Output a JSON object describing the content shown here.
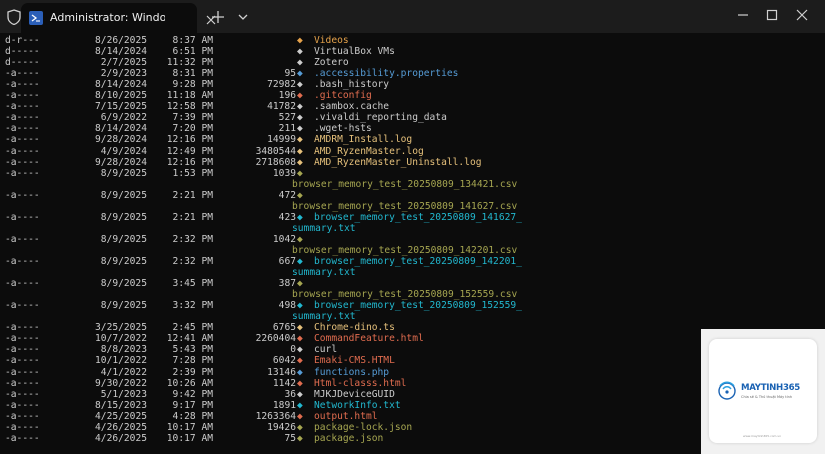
{
  "window": {
    "tab_title": "Administrator: Windows Powe",
    "tab_icon": "powershell-icon"
  },
  "colors": {
    "terminal_bg": "#0c0c0c",
    "titlebar_bg": "#1c1c1c",
    "default_text": "#cccccc",
    "yellow": "#e5c07b",
    "blue": "#569cd6",
    "red": "#e06c4f",
    "cyan": "#22b8cf",
    "olive": "#a6a651"
  },
  "listing": [
    {
      "mode": "d-r---",
      "date": "8/26/2025",
      "time": "8:37",
      "ampm": "AM",
      "size": "",
      "icon": "◆",
      "icon_color": "#e5a24b",
      "name": "Videos",
      "name_color": "#e5a24b"
    },
    {
      "mode": "d-----",
      "date": "8/14/2024",
      "time": "6:51",
      "ampm": "PM",
      "size": "",
      "icon": "◆",
      "icon_color": "#cccccc",
      "name": "VirtualBox VMs",
      "name_color": "#cccccc"
    },
    {
      "mode": "d-----",
      "date": "2/7/2025",
      "time": "11:32",
      "ampm": "PM",
      "size": "",
      "icon": "◆",
      "icon_color": "#cccccc",
      "name": "Zotero",
      "name_color": "#cccccc"
    },
    {
      "mode": "-a----",
      "date": "2/9/2023",
      "time": "8:31",
      "ampm": "PM",
      "size": "95",
      "icon": "◆",
      "icon_color": "#569cd6",
      "name": ".accessibility.properties",
      "name_color": "#569cd6"
    },
    {
      "mode": "-a----",
      "date": "8/14/2024",
      "time": "9:28",
      "ampm": "PM",
      "size": "72982",
      "icon": "◆",
      "icon_color": "#cccccc",
      "name": ".bash_history",
      "name_color": "#cccccc"
    },
    {
      "mode": "-a----",
      "date": "8/10/2025",
      "time": "11:18",
      "ampm": "AM",
      "size": "196",
      "icon": "◆",
      "icon_color": "#e06c4f",
      "name": ".gitconfig",
      "name_color": "#e06c4f"
    },
    {
      "mode": "-a----",
      "date": "7/15/2025",
      "time": "12:58",
      "ampm": "PM",
      "size": "41782",
      "icon": "◆",
      "icon_color": "#cccccc",
      "name": ".sambox.cache",
      "name_color": "#cccccc"
    },
    {
      "mode": "-a----",
      "date": "6/9/2022",
      "time": "7:39",
      "ampm": "PM",
      "size": "527",
      "icon": "◆",
      "icon_color": "#cccccc",
      "name": ".vivaldi_reporting_data",
      "name_color": "#cccccc"
    },
    {
      "mode": "-a----",
      "date": "8/14/2024",
      "time": "7:20",
      "ampm": "PM",
      "size": "211",
      "icon": "◆",
      "icon_color": "#cccccc",
      "name": ".wget-hsts",
      "name_color": "#cccccc"
    },
    {
      "mode": "-a----",
      "date": "9/28/2024",
      "time": "12:16",
      "ampm": "PM",
      "size": "14999",
      "icon": "◆",
      "icon_color": "#e5c07b",
      "name": "AMDRM_Install.log",
      "name_color": "#e5c07b"
    },
    {
      "mode": "-a----",
      "date": "4/9/2024",
      "time": "12:49",
      "ampm": "PM",
      "size": "3480544",
      "icon": "◆",
      "icon_color": "#e5c07b",
      "name": "AMD_RyzenMaster.log",
      "name_color": "#e5c07b"
    },
    {
      "mode": "-a----",
      "date": "9/28/2024",
      "time": "12:16",
      "ampm": "PM",
      "size": "2718608",
      "icon": "◆",
      "icon_color": "#e5c07b",
      "name": "AMD_RyzenMaster_Uninstall.log",
      "name_color": "#e5c07b"
    },
    {
      "mode": "-a----",
      "date": "8/9/2025",
      "time": "1:53",
      "ampm": "PM",
      "size": "1039",
      "icon": "◆",
      "icon_color": "#a6a651",
      "name": "",
      "name_color": "#a6a651"
    },
    {
      "mode": "",
      "date": "",
      "time": "",
      "ampm": "",
      "size": "",
      "icon": "",
      "icon_color": "#a6a651",
      "name": "browser_memory_test_20250809_134421.csv",
      "name_color": "#a6a651",
      "wrap": true
    },
    {
      "mode": "-a----",
      "date": "8/9/2025",
      "time": "2:21",
      "ampm": "PM",
      "size": "472",
      "icon": "◆",
      "icon_color": "#a6a651",
      "name": "",
      "name_color": "#a6a651"
    },
    {
      "mode": "",
      "date": "",
      "time": "",
      "ampm": "",
      "size": "",
      "icon": "",
      "icon_color": "#a6a651",
      "name": "browser_memory_test_20250809_141627.csv",
      "name_color": "#a6a651",
      "wrap": true
    },
    {
      "mode": "-a----",
      "date": "8/9/2025",
      "time": "2:21",
      "ampm": "PM",
      "size": "423",
      "icon": "◆",
      "icon_color": "#22b8cf",
      "name": "browser_memory_test_20250809_141627_",
      "name_color": "#22b8cf"
    },
    {
      "mode": "",
      "date": "",
      "time": "",
      "ampm": "",
      "size": "",
      "icon": "",
      "icon_color": "#22b8cf",
      "name": "summary.txt",
      "name_color": "#22b8cf",
      "wrap": true
    },
    {
      "mode": "-a----",
      "date": "8/9/2025",
      "time": "2:32",
      "ampm": "PM",
      "size": "1042",
      "icon": "◆",
      "icon_color": "#a6a651",
      "name": "",
      "name_color": "#a6a651"
    },
    {
      "mode": "",
      "date": "",
      "time": "",
      "ampm": "",
      "size": "",
      "icon": "",
      "icon_color": "#a6a651",
      "name": "browser_memory_test_20250809_142201.csv",
      "name_color": "#a6a651",
      "wrap": true
    },
    {
      "mode": "-a----",
      "date": "8/9/2025",
      "time": "2:32",
      "ampm": "PM",
      "size": "667",
      "icon": "◆",
      "icon_color": "#22b8cf",
      "name": "browser_memory_test_20250809_142201_",
      "name_color": "#22b8cf"
    },
    {
      "mode": "",
      "date": "",
      "time": "",
      "ampm": "",
      "size": "",
      "icon": "",
      "icon_color": "#22b8cf",
      "name": "summary.txt",
      "name_color": "#22b8cf",
      "wrap": true
    },
    {
      "mode": "-a----",
      "date": "8/9/2025",
      "time": "3:45",
      "ampm": "PM",
      "size": "387",
      "icon": "◆",
      "icon_color": "#a6a651",
      "name": "",
      "name_color": "#a6a651"
    },
    {
      "mode": "",
      "date": "",
      "time": "",
      "ampm": "",
      "size": "",
      "icon": "",
      "icon_color": "#a6a651",
      "name": "browser_memory_test_20250809_152559.csv",
      "name_color": "#a6a651",
      "wrap": true
    },
    {
      "mode": "-a----",
      "date": "8/9/2025",
      "time": "3:32",
      "ampm": "PM",
      "size": "498",
      "icon": "◆",
      "icon_color": "#22b8cf",
      "name": "browser_memory_test_20250809_152559_",
      "name_color": "#22b8cf"
    },
    {
      "mode": "",
      "date": "",
      "time": "",
      "ampm": "",
      "size": "",
      "icon": "",
      "icon_color": "#22b8cf",
      "name": "summary.txt",
      "name_color": "#22b8cf",
      "wrap": true
    },
    {
      "mode": "-a----",
      "date": "3/25/2025",
      "time": "2:45",
      "ampm": "PM",
      "size": "6765",
      "icon": "◆",
      "icon_color": "#e5c07b",
      "name": "Chrome-dino.ts",
      "name_color": "#e5c07b"
    },
    {
      "mode": "-a----",
      "date": "10/7/2022",
      "time": "12:41",
      "ampm": "AM",
      "size": "2260404",
      "icon": "◆",
      "icon_color": "#e06c4f",
      "name": "CommandFeature.html",
      "name_color": "#e06c4f"
    },
    {
      "mode": "-a----",
      "date": "8/8/2023",
      "time": "5:43",
      "ampm": "PM",
      "size": "0",
      "icon": "◆",
      "icon_color": "#cccccc",
      "name": "curl",
      "name_color": "#cccccc"
    },
    {
      "mode": "-a----",
      "date": "10/1/2022",
      "time": "7:28",
      "ampm": "PM",
      "size": "6042",
      "icon": "◆",
      "icon_color": "#e06c4f",
      "name": "Emaki-CMS.HTML",
      "name_color": "#e06c4f"
    },
    {
      "mode": "-a----",
      "date": "4/1/2022",
      "time": "2:39",
      "ampm": "PM",
      "size": "13146",
      "icon": "◆",
      "icon_color": "#569cd6",
      "name": "functions.php",
      "name_color": "#569cd6"
    },
    {
      "mode": "-a----",
      "date": "9/30/2022",
      "time": "10:26",
      "ampm": "AM",
      "size": "1142",
      "icon": "◆",
      "icon_color": "#e06c4f",
      "name": "Html-classs.html",
      "name_color": "#e06c4f"
    },
    {
      "mode": "-a----",
      "date": "5/1/2023",
      "time": "9:42",
      "ampm": "PM",
      "size": "36",
      "icon": "◆",
      "icon_color": "#cccccc",
      "name": "MJKJDeviceGUID",
      "name_color": "#cccccc"
    },
    {
      "mode": "-a----",
      "date": "8/15/2023",
      "time": "9:17",
      "ampm": "PM",
      "size": "1891",
      "icon": "◆",
      "icon_color": "#22b8cf",
      "name": "NetworkInfo.txt",
      "name_color": "#22b8cf"
    },
    {
      "mode": "-a----",
      "date": "4/25/2025",
      "time": "4:28",
      "ampm": "PM",
      "size": "1263364",
      "icon": "◆",
      "icon_color": "#e06c4f",
      "name": "output.html",
      "name_color": "#e06c4f"
    },
    {
      "mode": "-a----",
      "date": "4/26/2025",
      "time": "10:17",
      "ampm": "AM",
      "size": "19426",
      "icon": "◆",
      "icon_color": "#a6a651",
      "name": "package-lock.json",
      "name_color": "#a6a651"
    },
    {
      "mode": "-a----",
      "date": "4/26/2025",
      "time": "10:17",
      "ampm": "AM",
      "size": "75",
      "icon": "◆",
      "icon_color": "#a6a651",
      "name": "package.json",
      "name_color": "#a6a651"
    }
  ],
  "watermark": {
    "brand": "MAYTINH365",
    "tagline": "Chia sẻ & Thủ thuật Máy tính",
    "url": "www.maytinh365.com.vn"
  }
}
